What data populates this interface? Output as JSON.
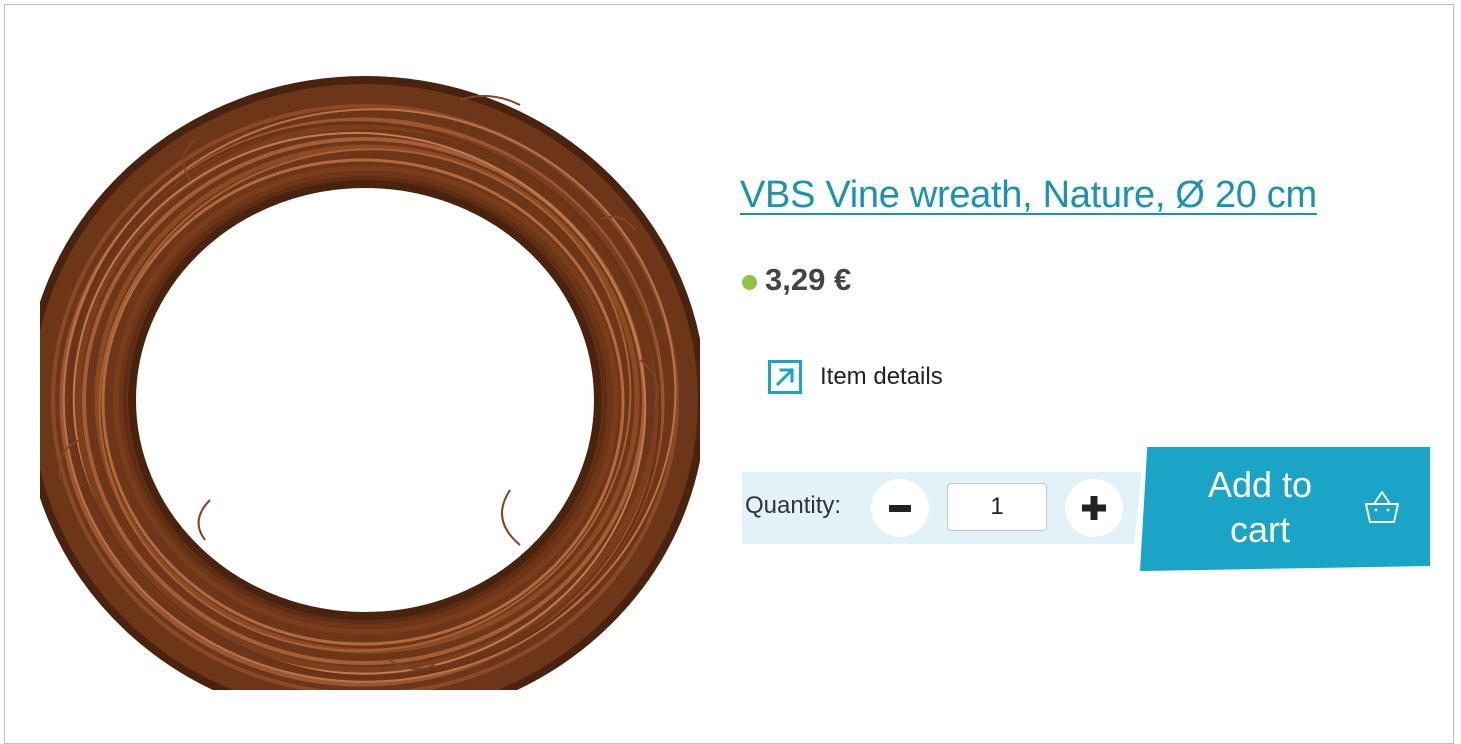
{
  "product": {
    "title": "VBS Vine wreath, Nature, Ø 20 cm",
    "price": "3,29 €",
    "availability_color": "#8dc63f",
    "image_alt": "Vine wreath"
  },
  "details_link": {
    "label": "Item details",
    "icon": "external-arrow-icon"
  },
  "quantity": {
    "label": "Quantity:",
    "value": "1",
    "decrement_icon": "minus-icon",
    "increment_icon": "plus-icon"
  },
  "cart": {
    "label": "Add to cart",
    "icon": "basket-icon"
  },
  "colors": {
    "accent": "#1aa5c6",
    "link": "#1993b0",
    "qty_band": "#e1f3f8"
  }
}
